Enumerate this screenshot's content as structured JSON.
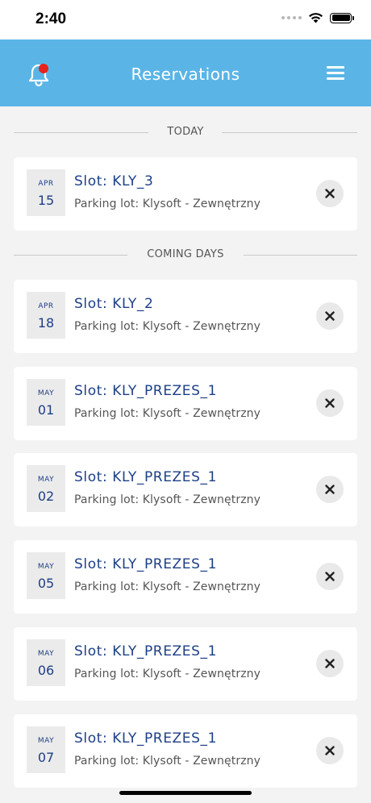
{
  "status_bar": {
    "time": "2:40"
  },
  "header": {
    "title": "Reservations"
  },
  "sections": {
    "today": "TODAY",
    "coming": "COMING DAYS"
  },
  "reservations": [
    {
      "month": "APR",
      "day": "15",
      "slot": "Slot: KLY_3",
      "lot": "Parking lot: Klysoft - Zewnętrzny"
    },
    {
      "month": "APR",
      "day": "18",
      "slot": "Slot: KLY_2",
      "lot": "Parking lot: Klysoft - Zewnętrzny"
    },
    {
      "month": "MAY",
      "day": "01",
      "slot": "Slot: KLY_PREZES_1",
      "lot": "Parking lot: Klysoft - Zewnętrzny"
    },
    {
      "month": "MAY",
      "day": "02",
      "slot": "Slot: KLY_PREZES_1",
      "lot": "Parking lot: Klysoft - Zewnętrzny"
    },
    {
      "month": "MAY",
      "day": "05",
      "slot": "Slot: KLY_PREZES_1",
      "lot": "Parking lot: Klysoft - Zewnętrzny"
    },
    {
      "month": "MAY",
      "day": "06",
      "slot": "Slot: KLY_PREZES_1",
      "lot": "Parking lot: Klysoft - Zewnętrzny"
    },
    {
      "month": "MAY",
      "day": "07",
      "slot": "Slot: KLY_PREZES_1",
      "lot": "Parking lot: Klysoft - Zewnętrzny"
    }
  ],
  "icons": {
    "notification": "bell-icon",
    "menu": "hamburger-menu-icon",
    "remove": "close-icon"
  },
  "colors": {
    "header_bg": "#5ab5e6",
    "accent_text": "#1d3f86",
    "notification_dot": "#e8231d"
  }
}
